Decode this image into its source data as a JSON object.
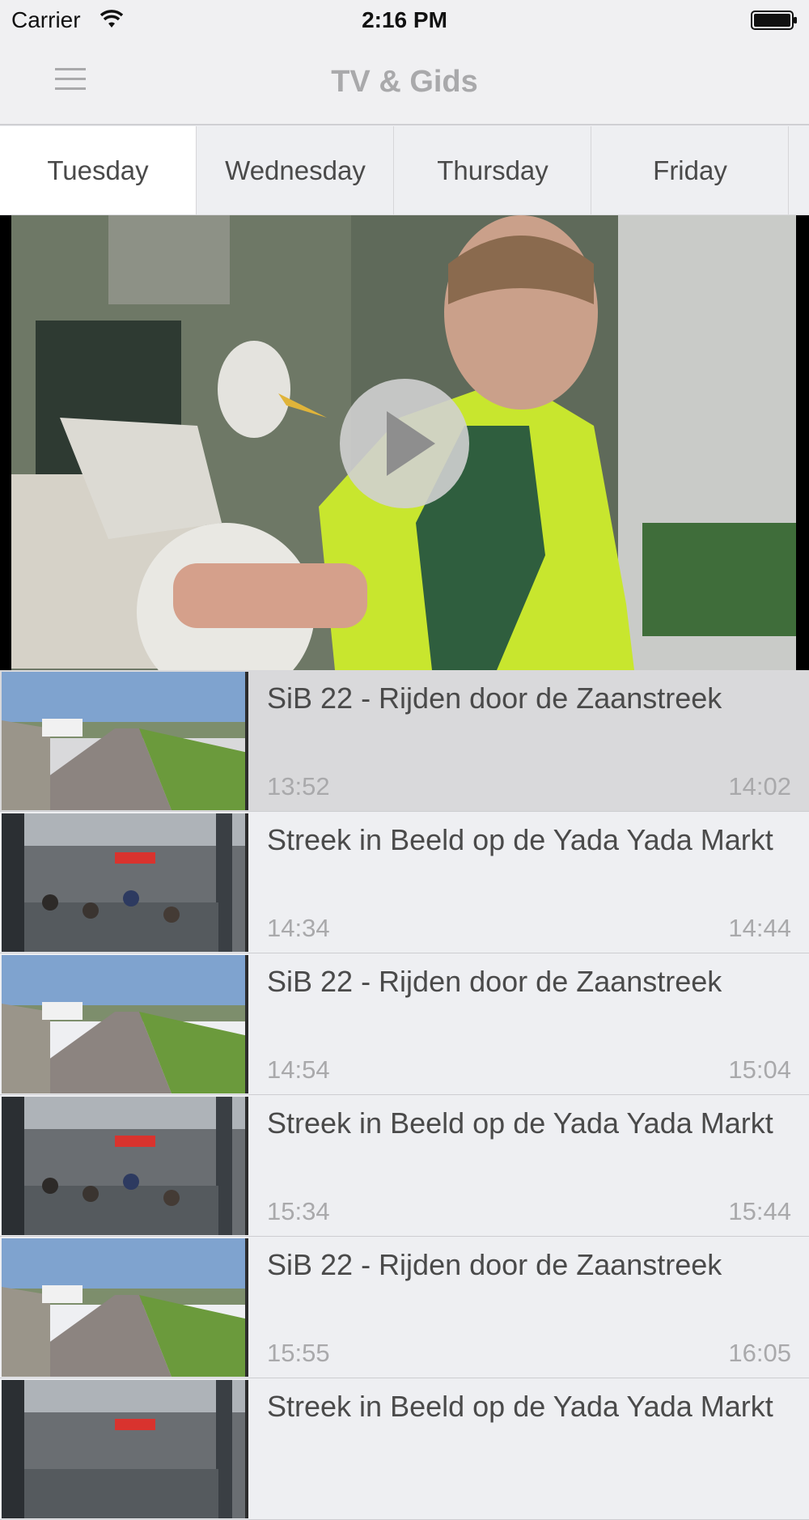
{
  "status_bar": {
    "carrier": "Carrier",
    "time": "2:16 PM",
    "icons": [
      "wifi-icon",
      "battery-icon"
    ]
  },
  "nav": {
    "title": "TV & Gids",
    "menu_icon": "hamburger-menu-icon"
  },
  "tabs": [
    {
      "label": "Tuesday",
      "active": true
    },
    {
      "label": "Wednesday",
      "active": false
    },
    {
      "label": "Thursday",
      "active": false
    },
    {
      "label": "Friday",
      "active": false
    }
  ],
  "player": {
    "play_icon": "play-icon"
  },
  "programs": [
    {
      "title": "SiB 22 - Rijden door de Zaanstreek",
      "start": "13:52",
      "end": "14:02",
      "selected": true,
      "thumb": "road"
    },
    {
      "title": "Streek in Beeld op de Yada Yada Markt",
      "start": "14:34",
      "end": "14:44",
      "selected": false,
      "thumb": "market"
    },
    {
      "title": "SiB 22 - Rijden door de Zaanstreek",
      "start": "14:54",
      "end": "15:04",
      "selected": false,
      "thumb": "road"
    },
    {
      "title": "Streek in Beeld op de Yada Yada Markt",
      "start": "15:34",
      "end": "15:44",
      "selected": false,
      "thumb": "market"
    },
    {
      "title": "SiB 22 - Rijden door de Zaanstreek",
      "start": "15:55",
      "end": "16:05",
      "selected": false,
      "thumb": "road"
    },
    {
      "title": "Streek in Beeld op de Yada Yada Markt",
      "start": "",
      "end": "",
      "selected": false,
      "thumb": "market"
    }
  ],
  "colors": {
    "background": "#eeeff2",
    "selected_row": "#d9d9db",
    "muted_text": "#a9a9ab",
    "text": "#4a4a4a"
  }
}
